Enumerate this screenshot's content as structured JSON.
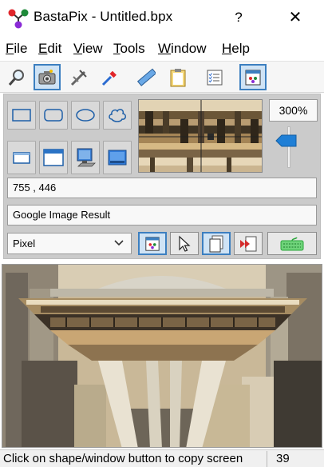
{
  "window": {
    "title": "BastaPix - Untitled.bpx",
    "help_btn": "?",
    "close_btn": "✕"
  },
  "menu": {
    "items": [
      {
        "label": "File",
        "accel": "F",
        "rest": "ile"
      },
      {
        "label": "Edit",
        "accel": "E",
        "rest": "dit"
      },
      {
        "label": "View",
        "accel": "V",
        "rest": "iew"
      },
      {
        "label": "Tools",
        "accel": "T",
        "rest": "ools"
      },
      {
        "label": "Window",
        "accel": "W",
        "rest": "indow"
      },
      {
        "label": "Help",
        "accel": "H",
        "rest": "elp"
      }
    ]
  },
  "toolbar": {
    "tools": [
      {
        "icon": "magnifier-icon",
        "active": false
      },
      {
        "icon": "camera-icon",
        "active": true
      },
      {
        "icon": "crosshair-tool-icon",
        "active": false
      },
      {
        "icon": "eyedropper-icon",
        "active": false
      },
      {
        "icon": "ruler-icon",
        "active": false
      },
      {
        "icon": "clipboard-icon",
        "active": false
      },
      {
        "icon": "checklist-icon",
        "active": false
      },
      {
        "icon": "capture-window-icon",
        "active": true
      }
    ]
  },
  "panel": {
    "zoom": "300%",
    "coords": "755 , 446",
    "window_title": "Google Image Result",
    "unit_select": "Pixel",
    "shape_buttons": [
      "rectangle-icon",
      "rounded-rectangle-icon",
      "ellipse-icon",
      "cloud-shape-icon",
      "window-frame-icon",
      "window-titlebar-icon",
      "computer-screen-icon",
      "desktop-icon"
    ]
  },
  "status": {
    "message": "Click on shape/window button to copy screen",
    "count": "39"
  },
  "colors": {
    "accent_border": "#3c7fc0",
    "active_fill": "#cfe3f5",
    "panel_bg": "#cbcbcb",
    "keyboard_green": "#2aa63a"
  }
}
